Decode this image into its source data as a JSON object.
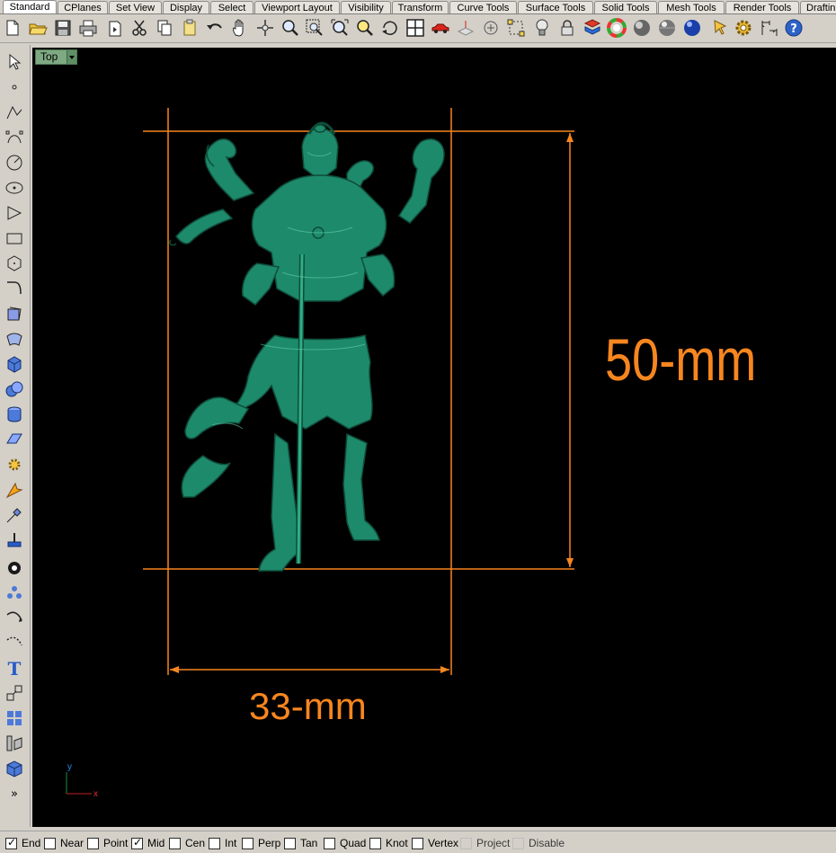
{
  "tabs": [
    {
      "label": "Standard",
      "active": true
    },
    {
      "label": "CPlanes"
    },
    {
      "label": "Set View"
    },
    {
      "label": "Display"
    },
    {
      "label": "Select"
    },
    {
      "label": "Viewport Layout"
    },
    {
      "label": "Visibility"
    },
    {
      "label": "Transform"
    },
    {
      "label": "Curve Tools"
    },
    {
      "label": "Surface Tools"
    },
    {
      "label": "Solid Tools"
    },
    {
      "label": "Mesh Tools"
    },
    {
      "label": "Render Tools"
    },
    {
      "label": "Draftin"
    }
  ],
  "toolbar_icons": [
    "new-file",
    "open-file",
    "save",
    "print",
    "import",
    "cut",
    "copy",
    "paste",
    "undo",
    "pan",
    "move-view",
    "zoom",
    "zoom-window",
    "zoom-extents",
    "zoom-selected",
    "rotate-view",
    "four-viewports",
    "car-view",
    "cplane",
    "object-snap-props",
    "named-positions",
    "light",
    "lock",
    "layer",
    "color-wheel",
    "shaded-sphere",
    "render-sphere",
    "material-sphere",
    "pointer-options",
    "settings",
    "dimension",
    "help"
  ],
  "left_toolbar_icons": [
    "select-arrow",
    "point",
    "polyline",
    "control-points",
    "circle",
    "ellipse",
    "arc",
    "rectangle",
    "polygon",
    "curve",
    "curve-from-objects",
    "surface",
    "box",
    "sphere",
    "cylinder",
    "planar-surface",
    "explode",
    "boolean",
    "extend",
    "trim",
    "split",
    "join",
    "group",
    "array",
    "fillet",
    "text",
    "scale",
    "transform",
    "layer-box",
    "more"
  ],
  "viewport": {
    "tab_label": "Top",
    "width_label": "33-mm",
    "height_label": "50-mm",
    "axis_x": "x",
    "axis_y": "y"
  },
  "colors": {
    "dimension": "#f7861f",
    "model": "#1d8a6b",
    "viewport_bg": "#000000"
  },
  "snaps": [
    {
      "label": "End",
      "checked": true
    },
    {
      "label": "Near",
      "checked": false
    },
    {
      "label": "Point",
      "checked": false
    },
    {
      "label": "Mid",
      "checked": true
    },
    {
      "label": "Cen",
      "checked": false
    },
    {
      "label": "Int",
      "checked": false
    },
    {
      "label": "Perp",
      "checked": false
    },
    {
      "label": "Tan",
      "checked": false
    },
    {
      "label": "Quad",
      "checked": false
    },
    {
      "label": "Knot",
      "checked": false
    },
    {
      "label": "Vertex",
      "checked": false
    },
    {
      "label": "Project",
      "checked": false,
      "disabled": true
    },
    {
      "label": "Disable",
      "checked": false,
      "disabled": true
    }
  ]
}
